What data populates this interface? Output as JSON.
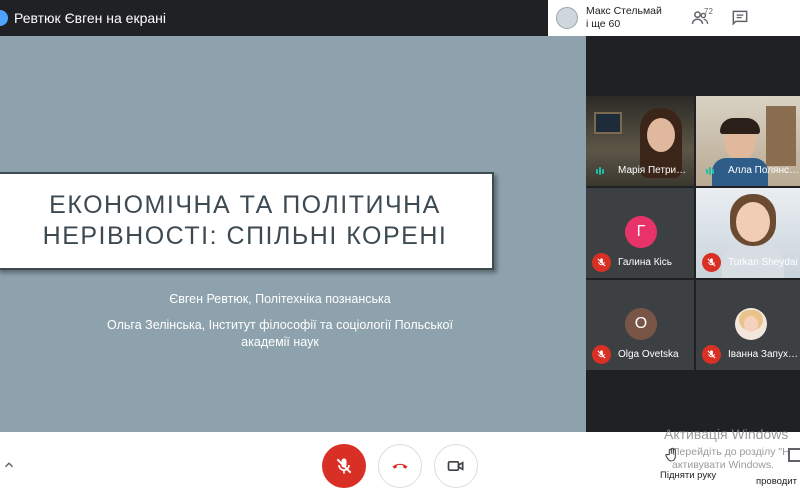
{
  "topbar": {
    "title": "Ревтюк Євген на екрані",
    "presenter_chip": {
      "line1": "Макс Стельмай",
      "line2": "і ще 60"
    },
    "participants_count": "72"
  },
  "slide": {
    "title_line1": "ЕКОНОМІЧНА ТА ПОЛІТИЧНА",
    "title_line2": "НЕРІВНОСТІ: СПІЛЬНІ КОРЕНІ",
    "author1": "Євген Ревтюк, Політехніка познанська",
    "author2_line1": "Ольга Зелінська, Інститут філософії та соціології Польської",
    "author2_line2": "академії наук"
  },
  "gallery": [
    {
      "name": "Марія Петри…",
      "mic": "on"
    },
    {
      "name": "Алла Полянс…",
      "mic": "on"
    },
    {
      "name": "Галина Кісь",
      "mic": "off",
      "initial": "Г",
      "color": "#e8336a"
    },
    {
      "name": "Turkan Sheydai",
      "mic": "off"
    },
    {
      "name": "Olga Ovetska",
      "mic": "off",
      "initial": "O",
      "color": "#795548"
    },
    {
      "name": "Іванна Запух…",
      "mic": "off"
    }
  ],
  "bottombar": {
    "raise_hand_label": "Підняти руку",
    "activation_title": "Активація Windows",
    "activation_sub1": "Перейдіть до розділу \"Н",
    "activation_sub2": "активувати Windows.",
    "description_label": "проводит"
  },
  "colors": {
    "slide_bg": "#8da2ad",
    "danger": "#d93025",
    "accent": "#19c1a8"
  }
}
